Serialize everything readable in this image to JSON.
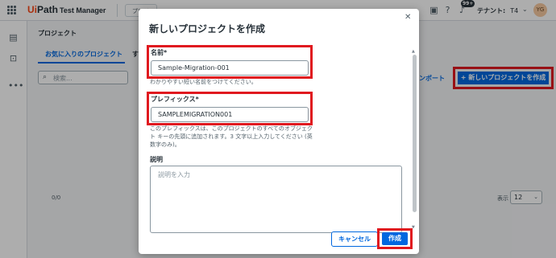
{
  "header": {
    "logo_path": "Ui",
    "logo_rest": "Path",
    "app_name": "Test Manager",
    "project_selector": "プロジェクトを選択",
    "notification_count": "99+",
    "tenant_label": "テナント:",
    "tenant_value": "T4",
    "avatar_initials": "YG"
  },
  "page": {
    "title": "プロジェクト",
    "tabs": [
      {
        "label": "お気に入りのプロジェクト",
        "active": true
      },
      {
        "label": "す"
      }
    ],
    "search_placeholder": "検索...",
    "import_label": "ンポート",
    "new_project_label": "+ 新しいプロジェクトを作成",
    "count_text": "0/0",
    "page_size_label": "表示",
    "page_size_value": "12"
  },
  "dialog": {
    "title": "新しいプロジェクトを作成",
    "name_label": "名前*",
    "name_value": "Sample-Migration-001",
    "name_helper": "わかりやすい短い名前をつけてください。",
    "prefix_label": "プレフィックス*",
    "prefix_value": "SAMPLEMIGRATION001",
    "prefix_helper_lines": [
      "このプレフィックスは、このプロジェクトのすべてのオブジェク",
      "ト キーの先頭に追加されます。3 文字以上入力してください (英",
      "数字のみ)。"
    ],
    "description_label": "説明",
    "description_placeholder": "説明を入力",
    "cancel_label": "キャンセル",
    "create_label": "作成"
  },
  "colors": {
    "accent": "#0067df",
    "highlight": "#e0191f",
    "brand_orange": "#fa4616"
  }
}
